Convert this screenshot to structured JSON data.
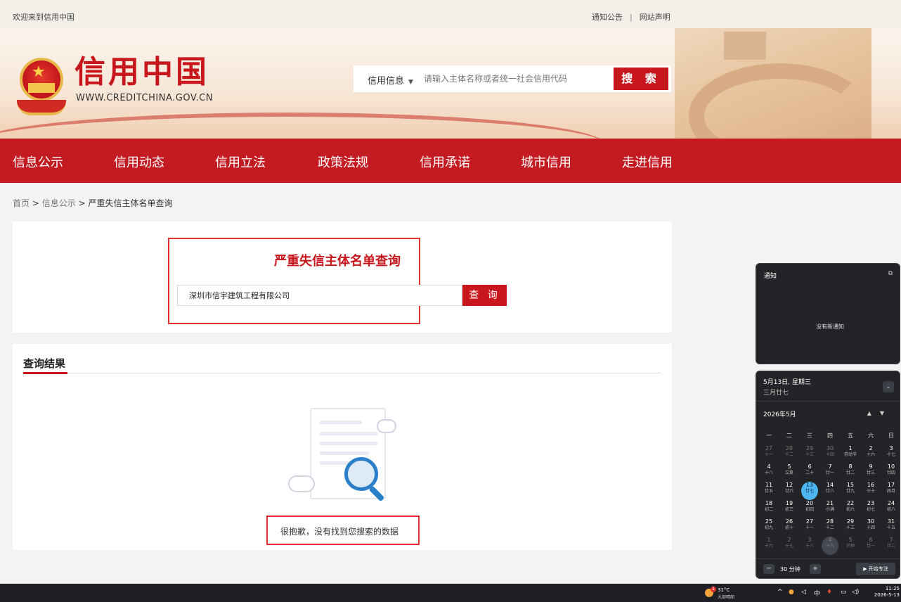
{
  "topbar": {
    "welcome": "欢迎来到信用中国",
    "link_notice": "通知公告",
    "separator": "|",
    "link_statement": "网站声明"
  },
  "header": {
    "logo_title": "信用中国",
    "logo_url": "WWW.CREDITCHINA.GOV.CN",
    "search": {
      "category": "信用信息",
      "placeholder": "请输入主体名称或者统一社会信用代码",
      "button": "搜 索"
    }
  },
  "nav": {
    "items": [
      "信息公示",
      "信用动态",
      "信用立法",
      "政策法规",
      "信用承诺",
      "城市信用",
      "走进信用"
    ]
  },
  "breadcrumb": {
    "home": "首页",
    "sep1": ">",
    "section": "信息公示",
    "sep2": ">",
    "current": "严重失信主体名单查询"
  },
  "query": {
    "title": "严重失信主体名单查询",
    "input_value": "深圳市信宇建筑工程有限公司",
    "button": "查 询"
  },
  "results": {
    "title": "查询结果",
    "empty_message": "很抱歉，没有找到您搜索的数据"
  },
  "notifications": {
    "title": "通知",
    "empty": "没有新通知"
  },
  "calendar": {
    "date_line": "5月13日, 星期三",
    "lunar_line": "三月廿七",
    "month_label": "2026年5月",
    "weekdays": [
      "一",
      "二",
      "三",
      "四",
      "五",
      "六",
      "日"
    ],
    "weeks": [
      [
        {
          "n": "27",
          "l": "十一",
          "dim": true
        },
        {
          "n": "28",
          "l": "十二",
          "dim": true
        },
        {
          "n": "29",
          "l": "十三",
          "dim": true
        },
        {
          "n": "30",
          "l": "十四",
          "dim": true
        },
        {
          "n": "1",
          "l": "劳动节"
        },
        {
          "n": "2",
          "l": "十六"
        },
        {
          "n": "3",
          "l": "十七"
        }
      ],
      [
        {
          "n": "4",
          "l": "十八"
        },
        {
          "n": "5",
          "l": "立夏"
        },
        {
          "n": "6",
          "l": "二十"
        },
        {
          "n": "7",
          "l": "廿一"
        },
        {
          "n": "8",
          "l": "廿二"
        },
        {
          "n": "9",
          "l": "廿三"
        },
        {
          "n": "10",
          "l": "廿四"
        }
      ],
      [
        {
          "n": "11",
          "l": "廿五"
        },
        {
          "n": "12",
          "l": "廿六"
        },
        {
          "n": "13",
          "l": "廿七",
          "today": true
        },
        {
          "n": "14",
          "l": "廿八"
        },
        {
          "n": "15",
          "l": "廿九"
        },
        {
          "n": "16",
          "l": "三十"
        },
        {
          "n": "17",
          "l": "四月"
        }
      ],
      [
        {
          "n": "18",
          "l": "初二"
        },
        {
          "n": "19",
          "l": "初三"
        },
        {
          "n": "20",
          "l": "初四"
        },
        {
          "n": "21",
          "l": "小满"
        },
        {
          "n": "22",
          "l": "初六"
        },
        {
          "n": "23",
          "l": "初七"
        },
        {
          "n": "24",
          "l": "初八"
        }
      ],
      [
        {
          "n": "25",
          "l": "初九"
        },
        {
          "n": "26",
          "l": "初十"
        },
        {
          "n": "27",
          "l": "十一"
        },
        {
          "n": "28",
          "l": "十二"
        },
        {
          "n": "29",
          "l": "十三"
        },
        {
          "n": "30",
          "l": "十四"
        },
        {
          "n": "31",
          "l": "十五"
        }
      ],
      [
        {
          "n": "1",
          "l": "十六",
          "dim": true
        },
        {
          "n": "2",
          "l": "十七",
          "dim": true
        },
        {
          "n": "3",
          "l": "十八",
          "dim": true
        },
        {
          "n": "4",
          "l": "十九",
          "dim": true,
          "ring": true
        },
        {
          "n": "5",
          "l": "芒种",
          "dim": true
        },
        {
          "n": "6",
          "l": "廿一",
          "dim": true
        },
        {
          "n": "7",
          "l": "廿二",
          "dim": true
        }
      ]
    ],
    "focus_duration": "30 分钟",
    "focus_button": "▶ 开始专注"
  },
  "taskbar": {
    "weather_temp": "31°C",
    "weather_desc": "大部晴朗",
    "weather_badge": "1",
    "tray_ime": "中",
    "time": "11:25",
    "date": "2026-5-13"
  }
}
